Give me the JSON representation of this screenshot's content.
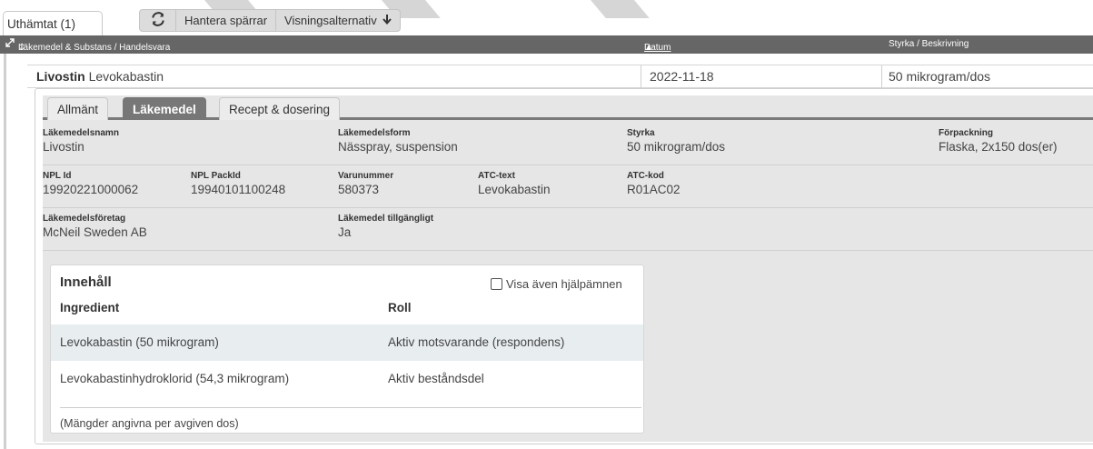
{
  "top": {
    "outhamtat_tab": "Uthämtat (1)",
    "hantera_sparrar": "Hantera spärrar",
    "visningsalternativ": "Visningsalternativ"
  },
  "columns": {
    "substance": "Läkemedel & Substans / Handelsvara",
    "date": "Datum",
    "strength": "Styrka / Beskrivning"
  },
  "record": {
    "brand": "Livostin",
    "substance": "Levokabastin",
    "date": "2022-11-18",
    "strength": "50 mikrogram/dos"
  },
  "subtabs": [
    "Allmänt",
    "Läkemedel",
    "Recept & dosering"
  ],
  "details": {
    "lakemedelsnamn": {
      "label": "Läkemedelsnamn",
      "value": "Livostin"
    },
    "lakemedelsform": {
      "label": "Läkemedelsform",
      "value": "Nässpray, suspension"
    },
    "styrka": {
      "label": "Styrka",
      "value": "50 mikrogram/dos"
    },
    "forpackning": {
      "label": "Förpackning",
      "value": "Flaska, 2x150 dos(er)"
    },
    "npl_id": {
      "label": "NPL Id",
      "value": "19920221000062"
    },
    "npl_packid": {
      "label": "NPL PackId",
      "value": "19940101100248"
    },
    "varunummer": {
      "label": "Varunummer",
      "value": "580373"
    },
    "atc_text": {
      "label": "ATC-text",
      "value": "Levokabastin"
    },
    "atc_kod": {
      "label": "ATC-kod",
      "value": "R01AC02"
    },
    "foretag": {
      "label": "Läkemedelsföretag",
      "value": "McNeil Sweden AB"
    },
    "tillgangligt": {
      "label": "Läkemedel tillgängligt",
      "value": "Ja"
    }
  },
  "ingredients": {
    "title": "Innehåll",
    "show_helpers": "Visa även hjälpämnen",
    "col_ingredient": "Ingredient",
    "col_role": "Roll",
    "rows": [
      {
        "ingredient": "Levokabastin (50 mikrogram)",
        "role": "Aktiv motsvarande (respondens)"
      },
      {
        "ingredient": "Levokabastinhydroklorid (54,3 mikrogram)",
        "role": "Aktiv beståndsdel"
      }
    ],
    "footnote": "(Mängder angivna per avgiven dos)"
  }
}
